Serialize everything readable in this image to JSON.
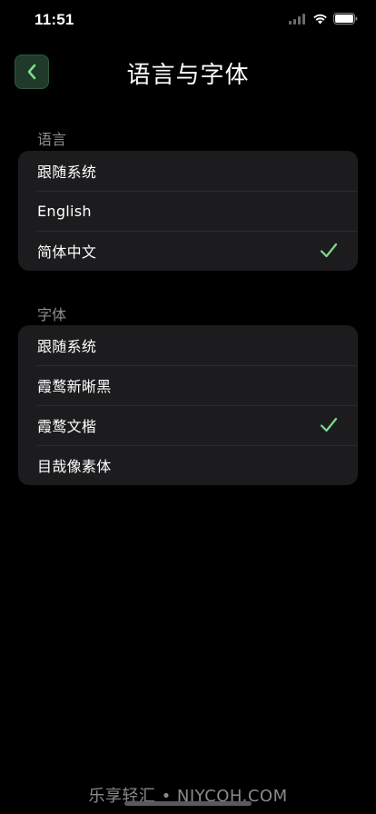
{
  "status_bar": {
    "time": "11:51"
  },
  "header": {
    "title": "语言与字体"
  },
  "language_section": {
    "label": "语言",
    "items": [
      {
        "label": "跟随系统",
        "selected": false
      },
      {
        "label": "English",
        "selected": false
      },
      {
        "label": "简体中文",
        "selected": true
      }
    ]
  },
  "font_section": {
    "label": "字体",
    "items": [
      {
        "label": "跟随系统",
        "selected": false
      },
      {
        "label": "霞鹜新晰黑",
        "selected": false
      },
      {
        "label": "霞鹜文楷",
        "selected": true
      },
      {
        "label": "目哉像素体",
        "selected": false
      }
    ]
  },
  "watermark": "乐享轻汇 • NJYCQH.COM",
  "colors": {
    "background": "#000000",
    "group_background": "#1c1c1e",
    "accent_check": "#7ddc8e",
    "back_button_bg": "#1f3a2a",
    "secondary_text": "#8e8e93"
  },
  "icons": {
    "back": "chevron-left-icon",
    "check": "checkmark-icon",
    "wifi": "wifi-icon",
    "battery": "battery-icon",
    "signal": "signal-icon"
  }
}
